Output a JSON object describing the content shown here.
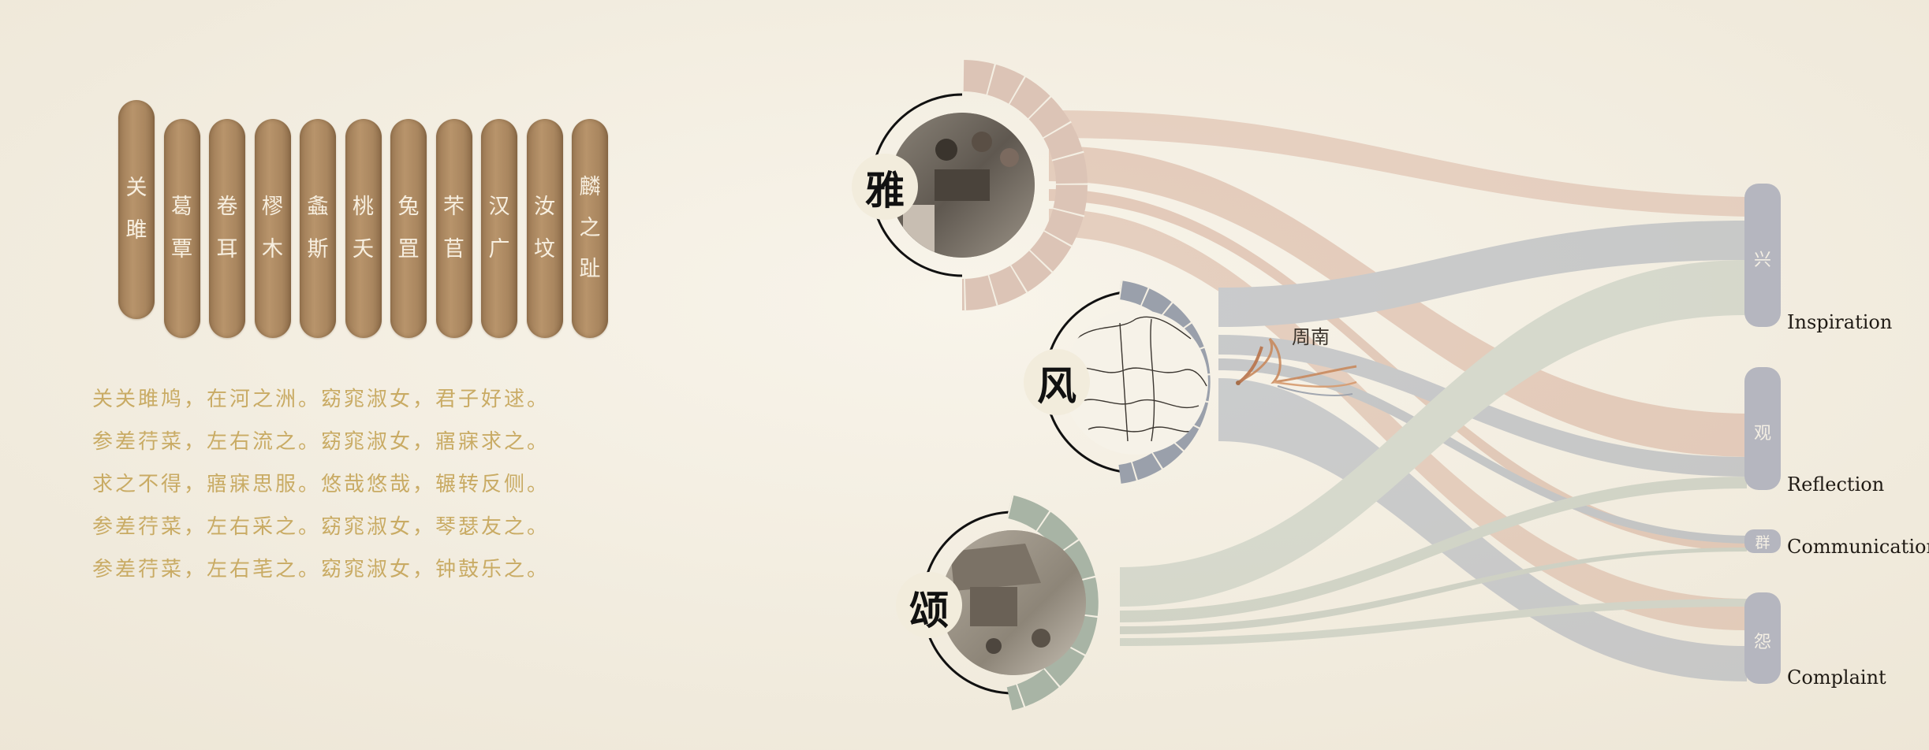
{
  "slips": [
    {
      "text": "关雎"
    },
    {
      "text": "葛覃"
    },
    {
      "text": "卷耳"
    },
    {
      "text": "樛木"
    },
    {
      "text": "螽斯"
    },
    {
      "text": "桃夭"
    },
    {
      "text": "兔罝"
    },
    {
      "text": "芣苢"
    },
    {
      "text": "汉广"
    },
    {
      "text": "汝坟"
    },
    {
      "text": "麟之趾"
    }
  ],
  "poem": [
    "关关雎鸠，在河之洲。窈窕淑女，君子好逑。",
    "参差荇菜，左右流之。窈窕淑女，寤寐求之。",
    "求之不得，寤寐思服。悠哉悠哉，辗转反侧。",
    "参差荇菜，左右采之。窈窕淑女，琴瑟友之。",
    "参差荇菜，左右芼之。窈窕淑女，钟鼓乐之。"
  ],
  "sources": [
    {
      "id": "ya",
      "char": "雅",
      "color": "#d7b7a6",
      "ring": "#d9bfb0"
    },
    {
      "id": "feng",
      "char": "风",
      "color": "#a9adb6",
      "ring": "#9aa0aa"
    },
    {
      "id": "song",
      "char": "颂",
      "color": "#b8c2b4",
      "ring": "#a7b3a4"
    }
  ],
  "region_label": "周南",
  "targets": [
    {
      "id": "xing",
      "char": "兴",
      "label": "Inspiration"
    },
    {
      "id": "guan",
      "char": "观",
      "label": "Reflection"
    },
    {
      "id": "qun",
      "char": "群",
      "label": "Communication"
    },
    {
      "id": "yuan",
      "char": "怨",
      "label": "Complaint"
    }
  ],
  "colors": {
    "background": "#f4efe3",
    "target_node": "#b7b8c1",
    "poem_text": "#c9ab64",
    "slip": "#a9865f"
  }
}
